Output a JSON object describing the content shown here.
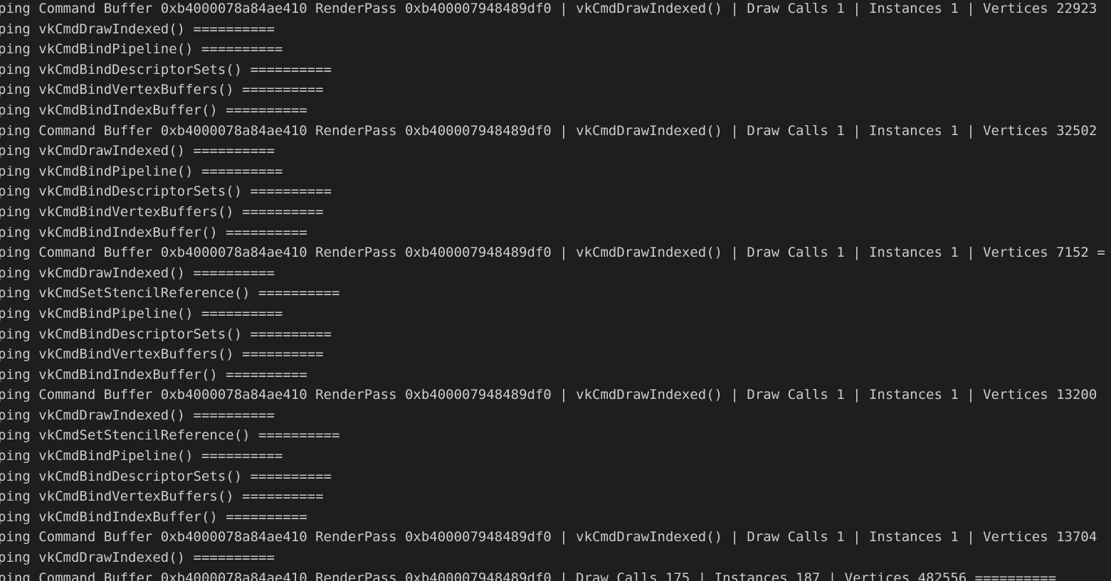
{
  "terminal": {
    "lines": [
      "ping Command Buffer 0xb4000078a84ae410 RenderPass 0xb400007948489df0 | vkCmdDrawIndexed() | Draw Calls 1 | Instances 1 | Vertices 22923",
      "ping vkCmdDrawIndexed() ==========",
      "ping vkCmdBindPipeline() ==========",
      "ping vkCmdBindDescriptorSets() ==========",
      "ping vkCmdBindVertexBuffers() ==========",
      "ping vkCmdBindIndexBuffer() ==========",
      "ping Command Buffer 0xb4000078a84ae410 RenderPass 0xb400007948489df0 | vkCmdDrawIndexed() | Draw Calls 1 | Instances 1 | Vertices 32502",
      "ping vkCmdDrawIndexed() ==========",
      "ping vkCmdBindPipeline() ==========",
      "ping vkCmdBindDescriptorSets() ==========",
      "ping vkCmdBindVertexBuffers() ==========",
      "ping vkCmdBindIndexBuffer() ==========",
      "ping Command Buffer 0xb4000078a84ae410 RenderPass 0xb400007948489df0 | vkCmdDrawIndexed() | Draw Calls 1 | Instances 1 | Vertices 7152 =",
      "ping vkCmdDrawIndexed() ==========",
      "ping vkCmdSetStencilReference() ==========",
      "ping vkCmdBindPipeline() ==========",
      "ping vkCmdBindDescriptorSets() ==========",
      "ping vkCmdBindVertexBuffers() ==========",
      "ping vkCmdBindIndexBuffer() ==========",
      "ping Command Buffer 0xb4000078a84ae410 RenderPass 0xb400007948489df0 | vkCmdDrawIndexed() | Draw Calls 1 | Instances 1 | Vertices 13200",
      "ping vkCmdDrawIndexed() ==========",
      "ping vkCmdSetStencilReference() ==========",
      "ping vkCmdBindPipeline() ==========",
      "ping vkCmdBindDescriptorSets() ==========",
      "ping vkCmdBindVertexBuffers() ==========",
      "ping vkCmdBindIndexBuffer() ==========",
      "ping Command Buffer 0xb4000078a84ae410 RenderPass 0xb400007948489df0 | vkCmdDrawIndexed() | Draw Calls 1 | Instances 1 | Vertices 13704",
      "ping vkCmdDrawIndexed() ==========",
      "ping Command Buffer 0xb4000078a84ae410 RenderPass 0xb400007948489df0 | Draw Calls 175 | Instances 187 | Vertices 482556 =========="
    ]
  },
  "colors": {
    "background": "#1e1e1e",
    "text": "#cccccc"
  }
}
